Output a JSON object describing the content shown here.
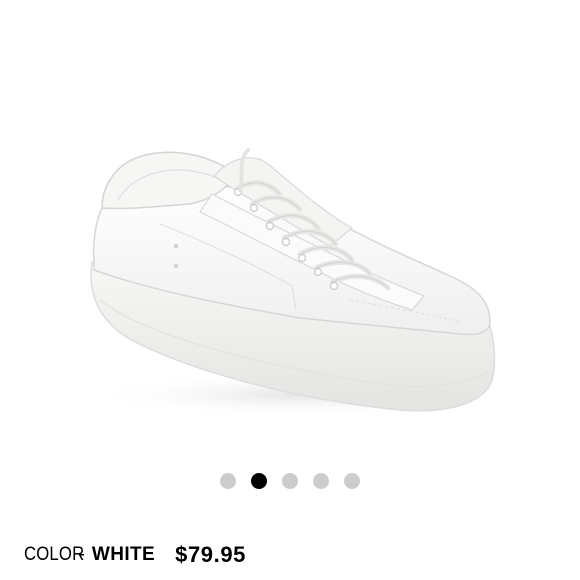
{
  "product": {
    "color_label": "COLOR",
    "separator": "-",
    "color_value": "WHITE",
    "price": "$79.95"
  },
  "image": {
    "subject": "white-platform-sneaker"
  },
  "carousel": {
    "total": 5,
    "active_index": 1
  },
  "colors": {
    "dot_active": "#000000",
    "dot_inactive": "#cccccc",
    "text": "#000000",
    "background": "#ffffff"
  }
}
